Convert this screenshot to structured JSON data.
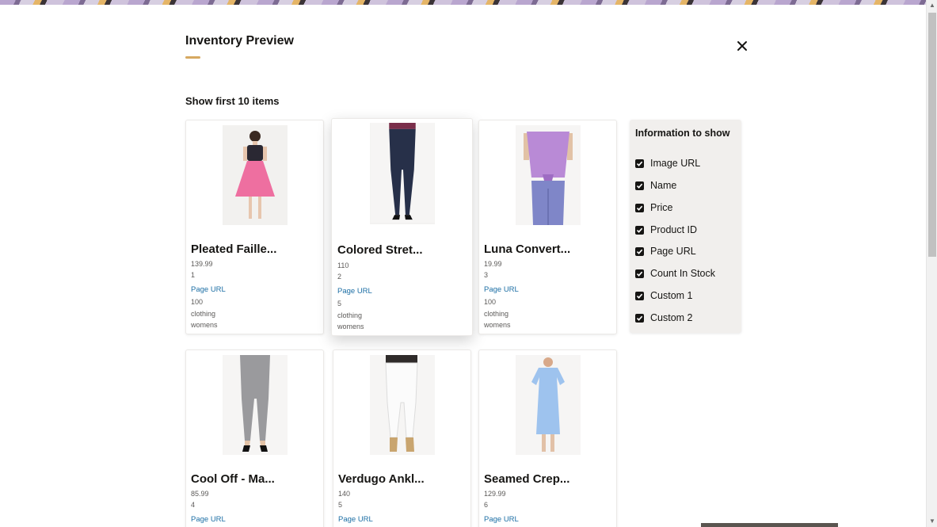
{
  "dialog": {
    "title": "Inventory Preview",
    "accent_color": "#d6a861",
    "show_first_label": "Show first 10 items"
  },
  "products": [
    {
      "name": "Pleated Faille...",
      "price": "139.99",
      "product_id": "1",
      "page_url": "Page URL",
      "count_in_stock": "100",
      "custom1": "clothing",
      "custom2": "womens",
      "image": "pink-skirt-dress-photo"
    },
    {
      "name": "Colored Stret...",
      "price": "110",
      "product_id": "2",
      "page_url": "Page URL",
      "count_in_stock": "5",
      "custom1": "clothing",
      "custom2": "womens",
      "image": "dark-jeans-photo"
    },
    {
      "name": "Luna Convert...",
      "price": "19.99",
      "product_id": "3",
      "page_url": "Page URL",
      "count_in_stock": "100",
      "custom1": "clothing",
      "custom2": "womens",
      "image": "lavender-top-photo"
    },
    {
      "name": "Cool Off - Ma...",
      "price": "85.99",
      "product_id": "4",
      "page_url": "Page URL",
      "image": "grey-jeans-photo"
    },
    {
      "name": "Verdugo Ankl...",
      "price": "140",
      "product_id": "5",
      "page_url": "Page URL",
      "image": "white-jeans-photo"
    },
    {
      "name": "Seamed Crep...",
      "price": "129.99",
      "product_id": "6",
      "page_url": "Page URL",
      "image": "blue-dress-photo"
    }
  ],
  "info_panel": {
    "title": "Information to show",
    "items": [
      {
        "label": "Image URL",
        "checked": true
      },
      {
        "label": "Name",
        "checked": true
      },
      {
        "label": "Price",
        "checked": true
      },
      {
        "label": "Product ID",
        "checked": true
      },
      {
        "label": "Page URL",
        "checked": true
      },
      {
        "label": "Count In Stock",
        "checked": true
      },
      {
        "label": "Custom 1",
        "checked": true
      },
      {
        "label": "Custom 2",
        "checked": true
      }
    ]
  },
  "icons": {
    "close": "close-icon",
    "check": "checkbox-checked-icon"
  },
  "colors": {
    "link": "#1d6fa5",
    "panel_bg": "#f1efed",
    "text": "#161513"
  }
}
